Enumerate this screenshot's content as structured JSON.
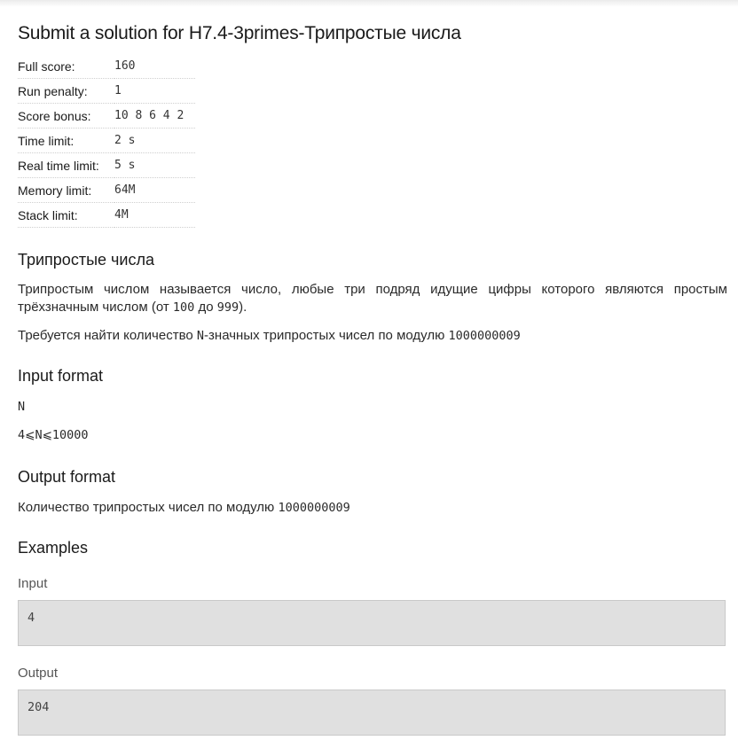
{
  "title": "Submit a solution for H7.4-3primes-Трипростые числа",
  "limits": [
    {
      "label": "Full score:",
      "value": "160"
    },
    {
      "label": "Run penalty:",
      "value": "1"
    },
    {
      "label": "Score bonus:",
      "value": "10 8 6 4 2"
    },
    {
      "label": "Time limit:",
      "value": "2 s"
    },
    {
      "label": "Real time limit:",
      "value": "5 s"
    },
    {
      "label": "Memory limit:",
      "value": "64M"
    },
    {
      "label": "Stack limit:",
      "value": "4M"
    }
  ],
  "statement": {
    "heading": "Трипростые числа",
    "p1_prefix": "Трипростым числом называется число, любые три подряд идущие цифры которого являются простым трёхзначным числом (от ",
    "p1_from": "100",
    "p1_mid": " до ",
    "p1_to": "999",
    "p1_suffix": ").",
    "p2_prefix": "Требуется найти количество ",
    "p2_var": "N",
    "p2_mid": "-значных трипростых чисел по модулю ",
    "p2_mod": "1000000009"
  },
  "input_format": {
    "heading": "Input format",
    "line1": "N",
    "line2": "4⩽N⩽10000"
  },
  "output_format": {
    "heading": "Output format",
    "text_prefix": "Количество трипростых чисел по модулю ",
    "text_mod": "1000000009"
  },
  "examples": {
    "heading": "Examples",
    "input_label": "Input",
    "input_value": "4",
    "output_label": "Output",
    "output_value": "204"
  }
}
